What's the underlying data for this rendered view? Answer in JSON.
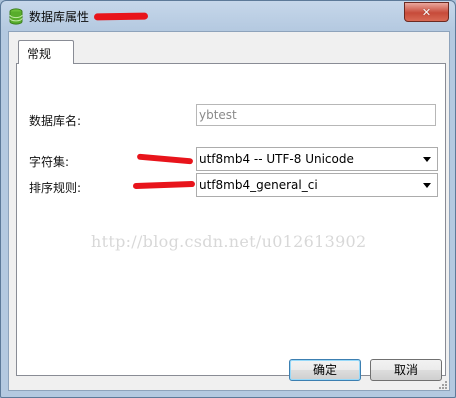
{
  "window": {
    "title": "数据库属性",
    "close_glyph": "✕",
    "icon": "database-icon"
  },
  "tabs": [
    {
      "label": "常规",
      "active": true
    }
  ],
  "form": {
    "db_name_label": "数据库名:",
    "db_name_value": "ybtest",
    "charset_label": "字符集:",
    "charset_value": "utf8mb4 -- UTF-8 Unicode",
    "collation_label": "排序规则:",
    "collation_value": "utf8mb4_general_ci"
  },
  "watermark": "http://blog.csdn.net/u012613902",
  "buttons": {
    "ok_label": "确定",
    "cancel_label": "取消"
  },
  "colors": {
    "redaction": "#e8141b",
    "close_button": "#c74b3a"
  }
}
